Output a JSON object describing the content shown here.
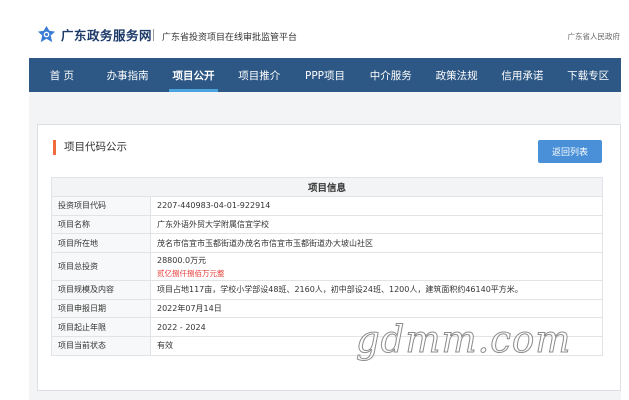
{
  "header": {
    "site_name": "广东政务服务网",
    "platform_name": "广东省投资项目在线审批监管平台",
    "gov_name": "广东省人民政府"
  },
  "nav": {
    "items": [
      {
        "label": "首 页"
      },
      {
        "label": "办事指南"
      },
      {
        "label": "项目公开",
        "active": true
      },
      {
        "label": "项目推介"
      },
      {
        "label": "PPP项目"
      },
      {
        "label": "中介服务"
      },
      {
        "label": "政策法规"
      },
      {
        "label": "信用承诺"
      },
      {
        "label": "下载专区"
      }
    ]
  },
  "panel": {
    "heading": "项目代码公示",
    "back_button": "返回列表"
  },
  "table": {
    "title": "项目信息",
    "rows": [
      {
        "label": "投资项目代码",
        "value": "2207-440983-04-01-922914"
      },
      {
        "label": "项目名称",
        "value": "广东外语外贸大学附属信宜学校"
      },
      {
        "label": "项目所在地",
        "value": "茂名市信宜市玉都街道办茂名市信宜市玉都街道办大坡山社区"
      },
      {
        "label": "项目总投资",
        "value": "28800.0万元",
        "value_words": "贰亿捌仟捌佰万元整"
      },
      {
        "label": "项目规模及内容",
        "value": "项目占地117亩，学校小学部设48班、2160人，初中部设24班、1200人，建筑面积约46140平方米。"
      },
      {
        "label": "项目申报日期",
        "value": "2022年07月14日"
      },
      {
        "label": "项目起止年限",
        "value": "2022 - 2024"
      },
      {
        "label": "项目当前状态",
        "value": "有效"
      }
    ]
  },
  "watermark": "gdmm.com",
  "colors": {
    "nav_bg": "#2d5784",
    "nav_active_underline": "#4aa3df",
    "accent_bar": "#ef6c3c",
    "button_bg": "#4a90d9",
    "amount_words": "#e53935"
  },
  "icons": {
    "logo": "guangdong-gov-logo-icon"
  }
}
